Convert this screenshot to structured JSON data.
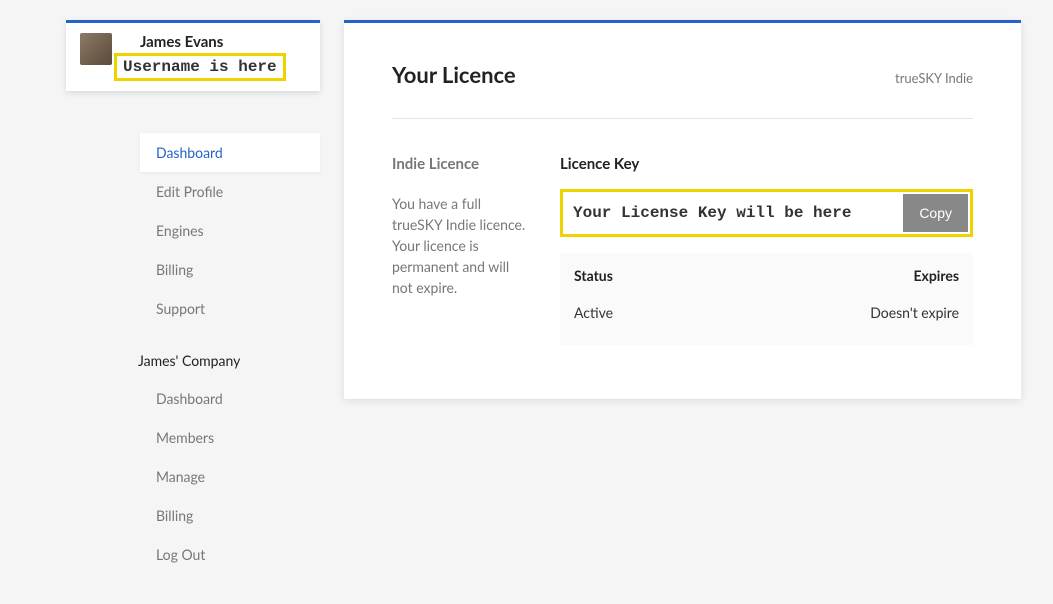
{
  "user": {
    "name": "James Evans",
    "handle": "Username is here"
  },
  "nav": {
    "personal": [
      "Dashboard",
      "Edit Profile",
      "Engines",
      "Billing",
      "Support"
    ],
    "company_header": "James' Company",
    "company": [
      "Dashboard",
      "Members",
      "Manage",
      "Billing",
      "Log Out"
    ]
  },
  "main": {
    "title": "Your Licence",
    "subtitle": "trueSKY Indie",
    "licence_heading": "Indie Licence",
    "licence_desc": "You have a full trueSKY Indie licence. Your licence is permanent and will not expire.",
    "key_heading": "Licence Key",
    "key_value": "Your License Key will be here",
    "copy_label": "Copy",
    "status_label": "Status",
    "expires_label": "Expires",
    "status_value": "Active",
    "expires_value": "Doesn't expire"
  }
}
